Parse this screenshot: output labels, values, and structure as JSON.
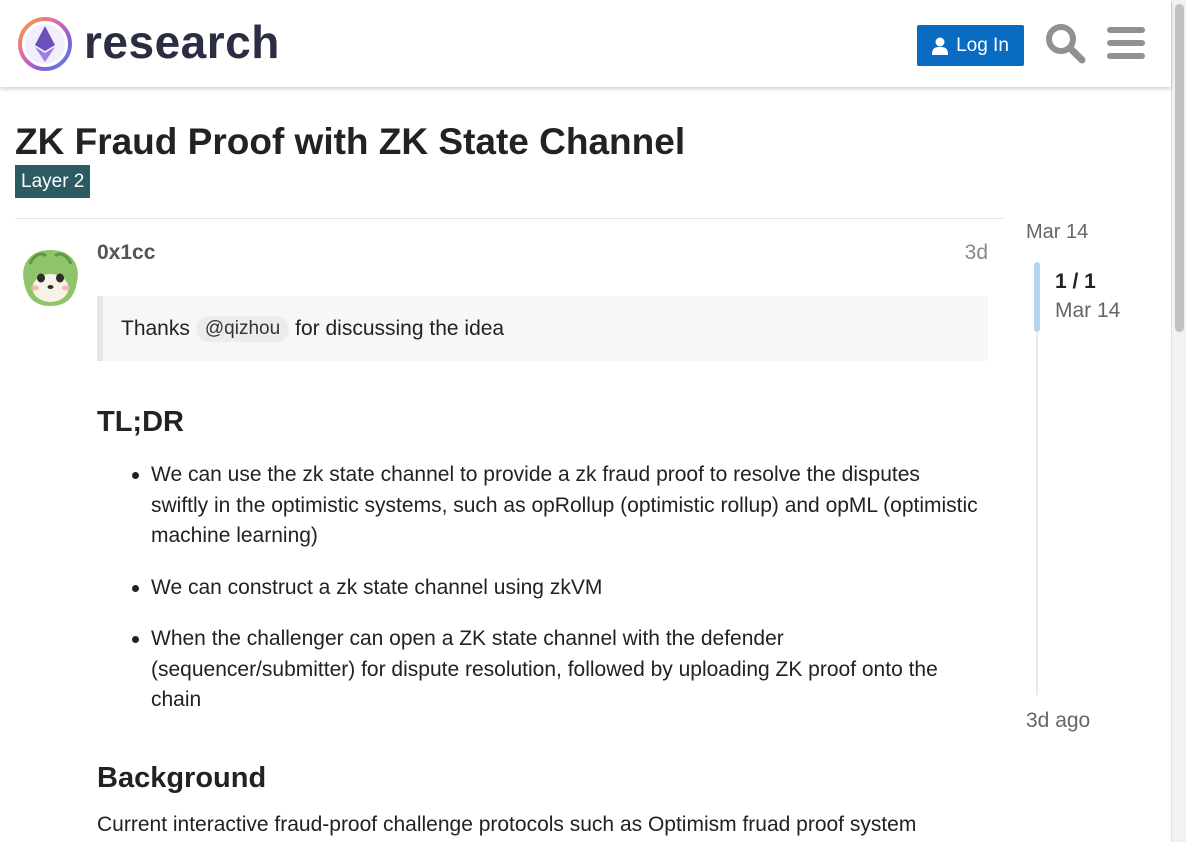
{
  "header": {
    "site_name": "research",
    "login_label": "Log In"
  },
  "topic": {
    "title": "ZK Fraud Proof with ZK State Channel",
    "category": "Layer 2"
  },
  "post": {
    "username": "0x1cc",
    "age": "3d",
    "quote": {
      "before": "Thanks",
      "mention": "@qizhou",
      "after": "for discussing the idea"
    },
    "tldr_heading": "TL;DR",
    "tldr_items": [
      "We can use the zk state channel to provide a zk fraud proof to resolve the disputes swiftly in the optimistic systems, such as opRollup (optimistic rollup) and opML (optimistic machine learning)",
      "We can construct a zk state channel using zkVM",
      "When the challenger can open a ZK state channel with the defender (sequencer/submitter) for dispute resolution, followed by uploading ZK proof onto the chain"
    ],
    "background_heading": "Background",
    "background_text": "Current interactive fraud-proof challenge protocols such as Optimism fruad proof system"
  },
  "timeline": {
    "start_date": "Mar 14",
    "position": "1 / 1",
    "position_date": "Mar 14",
    "end_label": "3d ago"
  },
  "icons": {
    "logo": "ethereum-research-logo",
    "user": "user-icon",
    "search": "search-icon",
    "menu": "hamburger-menu-icon"
  },
  "colors": {
    "primary_button": "#0a6bc2",
    "category_badge": "#2c5c62",
    "timeline_thumb": "#b4d5f0"
  }
}
